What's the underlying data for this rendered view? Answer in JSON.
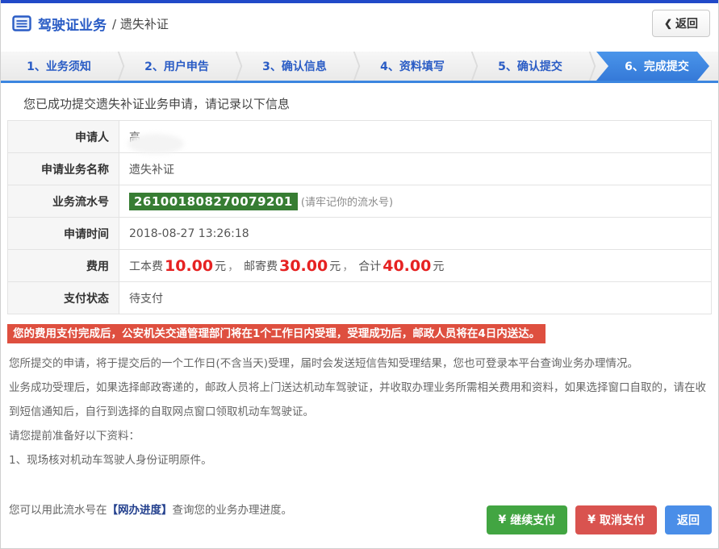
{
  "colors": {
    "topbar_blue": "#2149c8",
    "accent_blue": "#2a5cc5",
    "active_step_blue": "#3c86e0",
    "serial_green": "#377d33",
    "warning_red": "#de4f3f",
    "fee_red": "#e62222",
    "button_green": "#42a542",
    "button_red": "#d9534f",
    "button_blue": "#4a8ee8"
  },
  "header": {
    "title": "驾驶证业务",
    "subtitle": "/ 遗失补证",
    "back_button": {
      "chevron": "❮",
      "label": "返回"
    }
  },
  "steps": [
    {
      "label": "1、业务须知",
      "active": false
    },
    {
      "label": "2、用户申告",
      "active": false
    },
    {
      "label": "3、确认信息",
      "active": false
    },
    {
      "label": "4、资料填写",
      "active": false
    },
    {
      "label": "5、确认提交",
      "active": false
    },
    {
      "label": "6、完成提交",
      "active": true
    }
  ],
  "main": {
    "success_message": "您已成功提交遗失补证业务申请，请记录以下信息",
    "table": {
      "applicant_label": "申请人",
      "applicant_value": "高",
      "service_label": "申请业务名称",
      "service_value": "遗失补证",
      "serial_label": "业务流水号",
      "serial_value": "261001808270079201",
      "serial_note": "(请牢记你的流水号)",
      "time_label": "申请时间",
      "time_value": "2018-08-27 13:26:18",
      "fee_label": "费用",
      "fee": {
        "item1_label": "工本费",
        "item1_value": "10.00",
        "unit": "元",
        "comma": "，",
        "item2_label": "邮寄费",
        "item2_value": "30.00",
        "total_label": "合计",
        "total_value": "40.00"
      },
      "status_label": "支付状态",
      "status_value": "待支付"
    },
    "warning": "您的费用支付完成后，公安机关交通管理部门将在1个工作日内受理，受理成功后，邮政人员将在4日内送达。",
    "notes": [
      "您所提交的申请，将于提交后的一个工作日(不含当天)受理，届时会发送短信告知受理结果，您也可登录本平台查询业务办理情况。",
      "业务成功受理后，如果选择邮政寄递的，邮政人员将上门送达机动车驾驶证，并收取办理业务所需相关费用和资料，如果选择窗口自取的，请在收到短信通知后，自行到选择的自取网点窗口领取机动车驾驶证。",
      "请您提前准备好以下资料：",
      "1、现场核对机动车驾驶人身份证明原件。"
    ],
    "progress_line": {
      "prefix": "您可以用此流水号在",
      "link": "【网办进度】",
      "suffix": "查询您的业务办理进度。"
    }
  },
  "footer_buttons": {
    "continue_pay": {
      "icon": "¥",
      "label": "继续支付"
    },
    "cancel_pay": {
      "icon": "¥",
      "label": "取消支付"
    },
    "back": {
      "label": "返回"
    }
  }
}
